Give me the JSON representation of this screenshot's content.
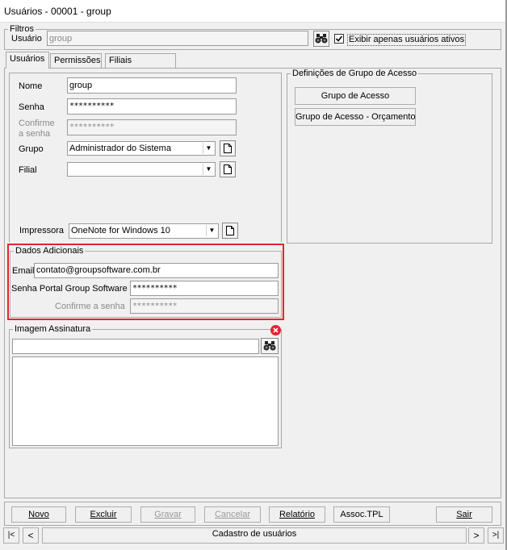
{
  "window": {
    "title": "Usuários - 00001 - group"
  },
  "filters": {
    "legend": "Filtros",
    "user_label": "Usuário",
    "user_value": "group",
    "active_only_label": "Exibir apenas usuários ativos",
    "active_only_checked": true
  },
  "tabs": [
    {
      "label": "Usuários",
      "active": true
    },
    {
      "label": "Permissões",
      "active": false
    },
    {
      "label": "Filiais Permitidas",
      "active": false
    }
  ],
  "user_form": {
    "name_label": "Nome",
    "name_value": "group",
    "password_label": "Senha",
    "password_value": "**********",
    "confirm_label_line1": "Confirme",
    "confirm_label_line2": "a senha",
    "confirm_value": "**********",
    "group_label": "Grupo",
    "group_value": "Administrador do Sistema",
    "branch_label": "Filial",
    "branch_value": "",
    "printer_label": "Impressora",
    "printer_value": "OneNote for Windows 10"
  },
  "access_group": {
    "legend": "Definições de Grupo de Acesso",
    "button1": "Grupo de Acesso",
    "button2": "Grupo de Acesso - Orçamento"
  },
  "additional_data": {
    "legend": "Dados Adicionais",
    "email_label": "Email",
    "email_value": "contato@groupsoftware.com.br",
    "portal_password_label": "Senha Portal Group Software",
    "portal_password_value": "**********",
    "confirm_label": "Confirme a senha",
    "confirm_value": "**********",
    "highlight_color": "#e0262f"
  },
  "signature": {
    "legend": "Imagem Assinatura",
    "path_value": ""
  },
  "toolbar": {
    "new": "Novo",
    "delete": "Excluir",
    "save": "Gravar",
    "cancel": "Cancelar",
    "report": "Relatório",
    "assoc": "Assoc.TPL",
    "exit": "Sair"
  },
  "status_bar": {
    "first": "|<",
    "prev": "<",
    "text": "Cadastro de usuários",
    "next": ">",
    "last": ">|"
  }
}
